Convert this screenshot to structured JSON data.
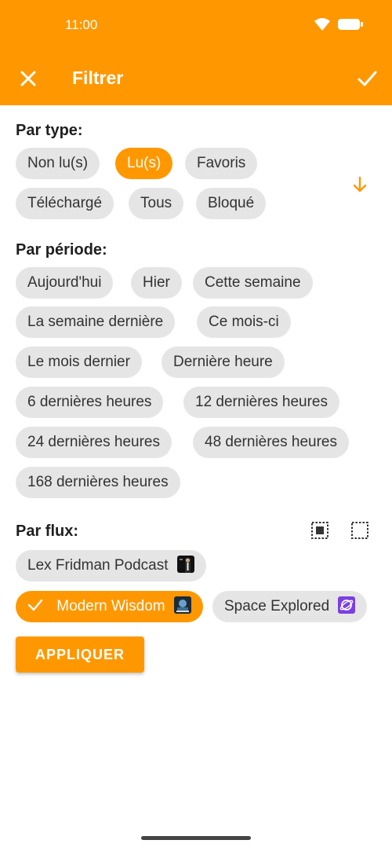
{
  "status": {
    "time": "11:00"
  },
  "header": {
    "title": "Filtrer"
  },
  "sections": {
    "type": {
      "title": "Par type:",
      "chips": [
        {
          "label": "Non lu(s)",
          "selected": false
        },
        {
          "label": "Lu(s)",
          "selected": true
        },
        {
          "label": "Favoris",
          "selected": false
        },
        {
          "label": "Téléchargé",
          "selected": false
        },
        {
          "label": "Tous",
          "selected": false
        },
        {
          "label": "Bloqué",
          "selected": false
        }
      ]
    },
    "period": {
      "title": "Par période:",
      "chips": [
        {
          "label": "Aujourd'hui"
        },
        {
          "label": "Hier"
        },
        {
          "label": "Cette semaine"
        },
        {
          "label": "La semaine dernière"
        },
        {
          "label": "Ce mois-ci"
        },
        {
          "label": "Le mois dernier"
        },
        {
          "label": "Dernière heure"
        },
        {
          "label": "6 dernières heures"
        },
        {
          "label": "12 dernières heures"
        },
        {
          "label": "24 dernières heures"
        },
        {
          "label": "48 dernières heures"
        },
        {
          "label": "168 dernières heures"
        }
      ]
    },
    "feeds": {
      "title": "Par flux:",
      "chips": [
        {
          "label": "Lex Fridman Podcast",
          "selected": false,
          "icon": "lex-fridman-thumbnail"
        },
        {
          "label": "Modern Wisdom",
          "selected": true,
          "icon": "modern-wisdom-thumbnail"
        },
        {
          "label": "Space Explored",
          "selected": false,
          "icon": "space-explored-thumbnail"
        }
      ]
    }
  },
  "apply_label": "APPLIQUER",
  "colors": {
    "accent": "#FF9800",
    "chip_bg": "#e5e5e5"
  }
}
